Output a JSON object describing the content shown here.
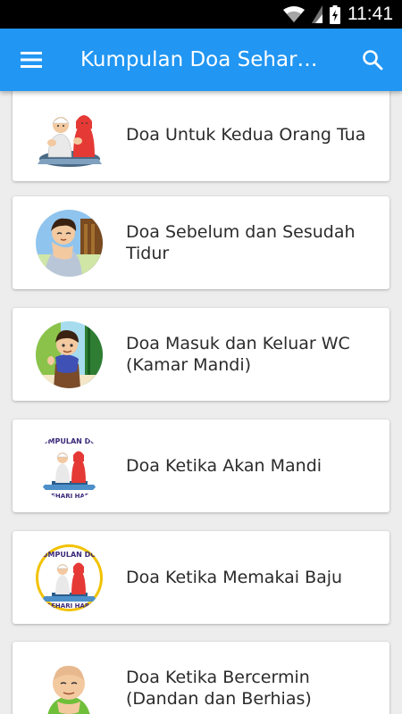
{
  "status": {
    "time": "11:41"
  },
  "appbar": {
    "title": "Kumpulan Doa Sehari-hari"
  },
  "items": [
    {
      "title": "Doa Untuk Kedua Orang Tua",
      "icon": "praying-couple-icon"
    },
    {
      "title": "Doa Sebelum dan Sesudah Tidur",
      "icon": "boy-bed-icon"
    },
    {
      "title": "Doa Masuk dan Keluar WC (Kamar Mandi)",
      "icon": "boy-door-icon"
    },
    {
      "title": "Doa Ketika Akan Mandi",
      "icon": "app-logo-icon",
      "logo_top": "KUMPULAN DOA",
      "logo_bottom": "SEHARI HARI"
    },
    {
      "title": "Doa Ketika Memakai Baju",
      "icon": "app-logo-icon",
      "logo_top": "KUMPULAN DOA",
      "logo_bottom": "SEHARI HARI"
    },
    {
      "title": "Doa Ketika Bercermin (Dandan dan Berhias)",
      "icon": "child-praying-icon"
    }
  ],
  "colors": {
    "appbar": "#2196f3",
    "statusbar": "#000000",
    "background": "#ededed"
  }
}
